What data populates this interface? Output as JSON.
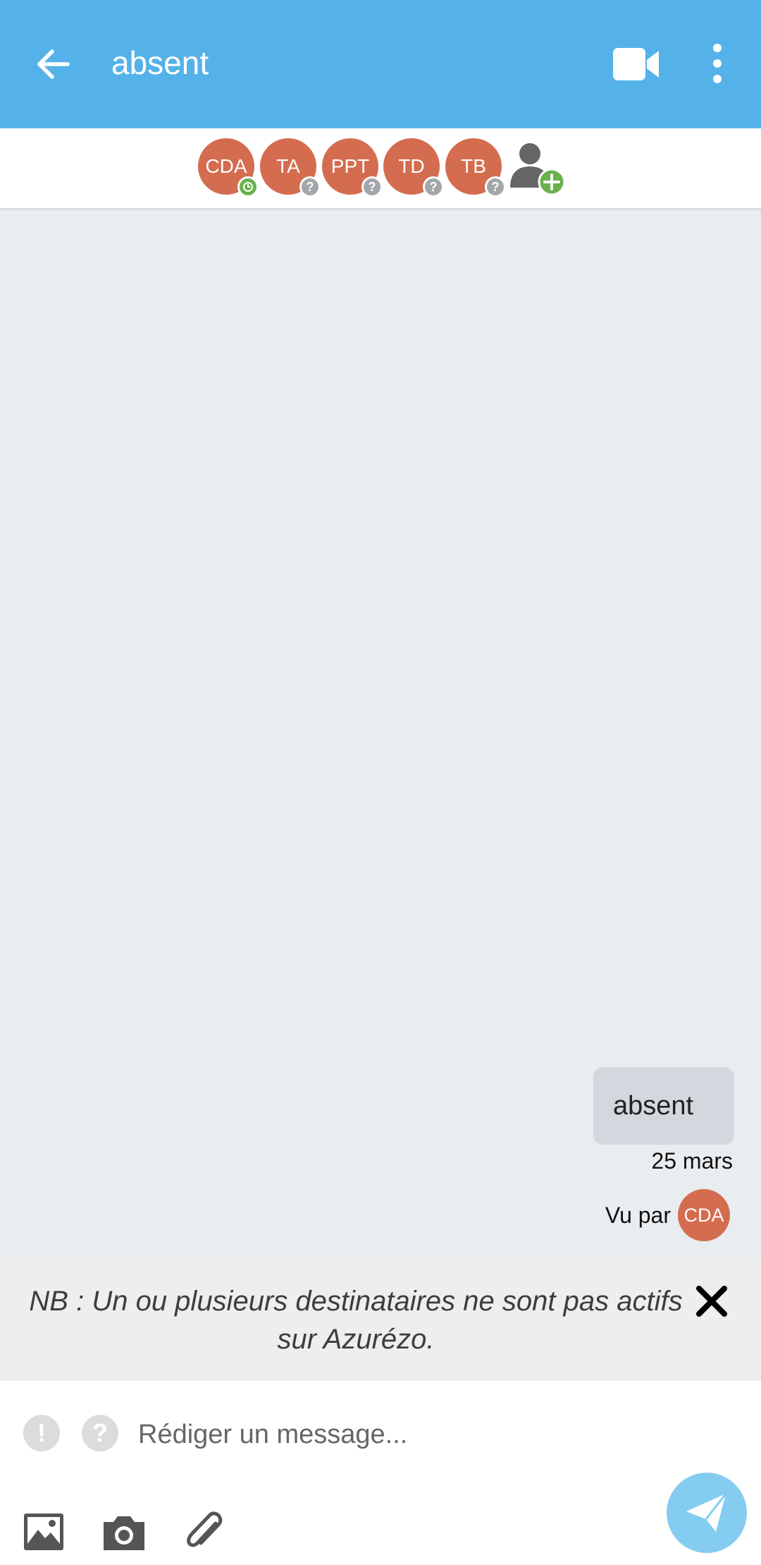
{
  "header": {
    "title": "absent",
    "back_icon": "arrow-left-icon",
    "video_icon": "video-camera-icon",
    "menu_icon": "more-vertical-icon"
  },
  "participants": [
    {
      "initials": "CDA",
      "status": "online-clock",
      "status_color": "#6ab04c"
    },
    {
      "initials": "TA",
      "status": "unknown",
      "status_color": "#a4a7aa"
    },
    {
      "initials": "PPT",
      "status": "unknown",
      "status_color": "#a4a7aa"
    },
    {
      "initials": "TD",
      "status": "unknown",
      "status_color": "#a4a7aa"
    },
    {
      "initials": "TB",
      "status": "unknown",
      "status_color": "#a4a7aa"
    }
  ],
  "add_participant_icon": "add-user-icon",
  "messages": [
    {
      "text": "absent",
      "date": "25 mars",
      "seen_label": "Vu par",
      "seen_by": "CDA"
    }
  ],
  "notice": {
    "text": "NB : Un ou plusieurs destinataires ne sont pas actifs sur Azurézo."
  },
  "composer": {
    "urgent_label": "!",
    "question_label": "?",
    "placeholder": "Rédiger un message...",
    "tools": [
      "image-icon",
      "camera-icon",
      "paperclip-icon"
    ],
    "send_icon": "send-icon"
  },
  "colors": {
    "appbar": "#55b2e9",
    "avatar": "#d46c4f",
    "chat_bg": "#eaedf0",
    "bubble": "#d3d8de",
    "send": "#85cdf0"
  }
}
